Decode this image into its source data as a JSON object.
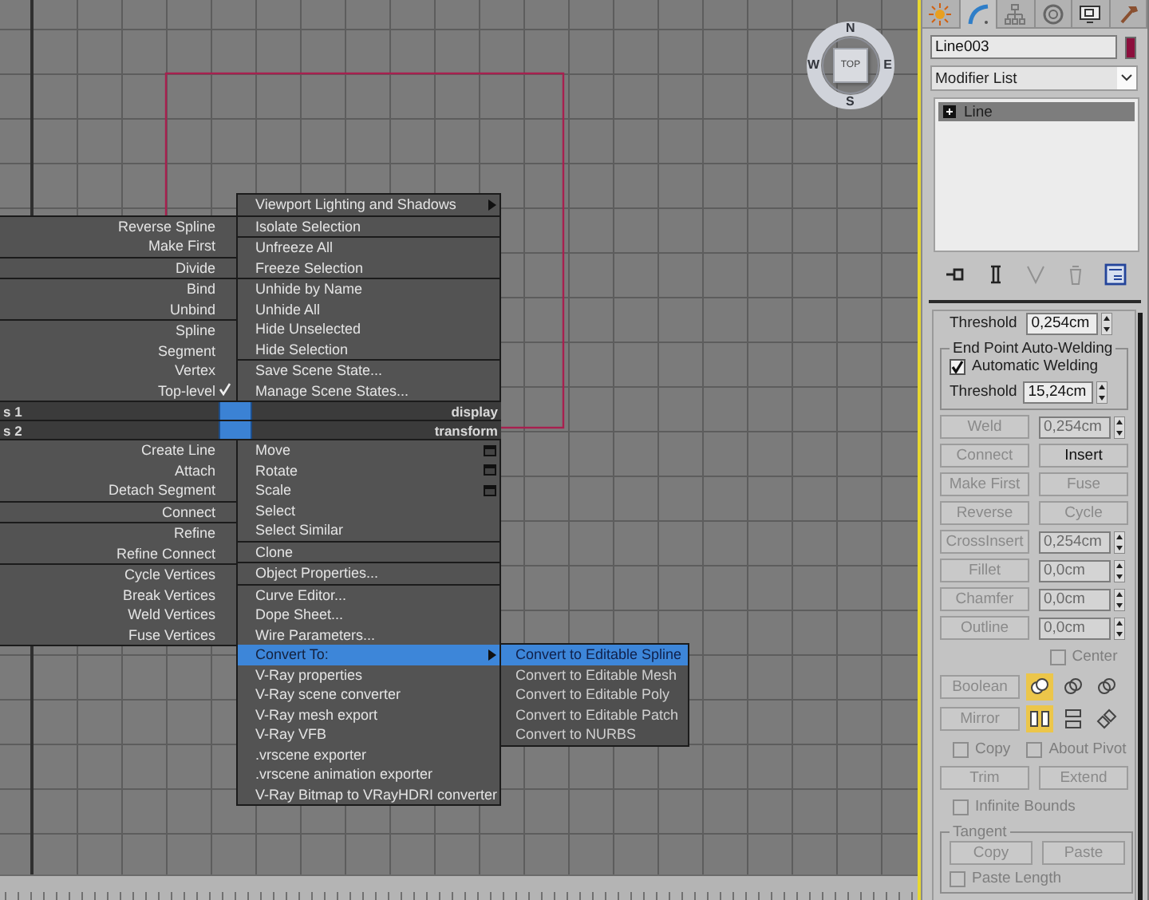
{
  "viewport": {
    "viewcube": {
      "face": "TOP",
      "north": "N",
      "east": "E",
      "south": "S",
      "west": "W"
    }
  },
  "quad_menu": {
    "upper_left": [
      [
        {
          "label": "Reverse Spline",
          "selected": false
        },
        {
          "label": "Make First",
          "selected": false
        }
      ],
      [
        {
          "label": "Divide",
          "selected": false
        }
      ],
      [
        {
          "label": "Bind",
          "selected": false
        },
        {
          "label": "Unbind",
          "selected": false
        }
      ],
      [
        {
          "label": "Spline",
          "selected": false,
          "checked": false
        },
        {
          "label": "Segment",
          "selected": false,
          "checked": false
        },
        {
          "label": "Vertex",
          "selected": false,
          "checked": false
        },
        {
          "label": "Top-level",
          "selected": false,
          "checked": true
        }
      ]
    ],
    "upper_right": [
      [
        {
          "label": "Viewport Lighting and Shadows",
          "kind": "submenu",
          "selected": false
        }
      ],
      [
        {
          "label": "Isolate Selection",
          "kind": "command",
          "selected": false
        }
      ],
      [
        {
          "label": "Unfreeze All",
          "kind": "command",
          "selected": false
        },
        {
          "label": "Freeze Selection",
          "kind": "command",
          "selected": false
        }
      ],
      [
        {
          "label": "Unhide by Name",
          "kind": "command",
          "selected": false
        },
        {
          "label": "Unhide All",
          "kind": "command",
          "selected": false
        },
        {
          "label": "Hide Unselected",
          "kind": "command",
          "selected": false
        },
        {
          "label": "Hide Selection",
          "kind": "command",
          "selected": false
        }
      ],
      [
        {
          "label": "Save Scene State...",
          "kind": "command",
          "selected": false
        },
        {
          "label": "Manage Scene States...",
          "kind": "command",
          "selected": false
        }
      ]
    ],
    "headers": [
      {
        "left": "s 1",
        "right": "display"
      },
      {
        "left": "s 2",
        "right": "transform"
      }
    ],
    "lower_left": [
      [
        {
          "label": "Create Line",
          "selected": false
        },
        {
          "label": "Attach",
          "selected": false
        },
        {
          "label": "Detach Segment",
          "selected": false
        }
      ],
      [
        {
          "label": "Connect",
          "selected": false
        }
      ],
      [
        {
          "label": "Refine",
          "selected": false
        },
        {
          "label": "Refine Connect",
          "selected": false
        }
      ],
      [
        {
          "label": "Cycle Vertices",
          "selected": false
        },
        {
          "label": "Break Vertices",
          "selected": false
        },
        {
          "label": "Weld Vertices",
          "selected": false
        },
        {
          "label": "Fuse Vertices",
          "selected": false
        }
      ]
    ],
    "lower_right": [
      [
        {
          "label": "Move",
          "kind": "option",
          "selected": false
        },
        {
          "label": "Rotate",
          "kind": "option",
          "selected": false
        },
        {
          "label": "Scale",
          "kind": "option",
          "selected": false
        },
        {
          "label": "Select",
          "kind": "command",
          "selected": false
        },
        {
          "label": "Select Similar",
          "kind": "command",
          "selected": false
        }
      ],
      [
        {
          "label": "Clone",
          "kind": "command",
          "selected": false
        }
      ],
      [
        {
          "label": "Object Properties...",
          "kind": "command",
          "selected": false
        }
      ],
      [
        {
          "label": "Curve Editor...",
          "kind": "command",
          "selected": false
        },
        {
          "label": "Dope Sheet...",
          "kind": "command",
          "selected": false
        },
        {
          "label": "Wire Parameters...",
          "kind": "command",
          "selected": false
        },
        {
          "label": "Convert To:",
          "kind": "submenu",
          "selected": true,
          "children": [
            {
              "label": "Convert to Editable Spline",
              "selected": true
            },
            {
              "label": "Convert to Editable Mesh",
              "selected": false
            },
            {
              "label": "Convert to Editable Poly",
              "selected": false
            },
            {
              "label": "Convert to Editable Patch",
              "selected": false
            },
            {
              "label": "Convert to NURBS",
              "selected": false
            }
          ]
        },
        {
          "label": "V-Ray properties",
          "kind": "command",
          "selected": false
        },
        {
          "label": "V-Ray scene converter",
          "kind": "command",
          "selected": false
        },
        {
          "label": "V-Ray mesh export",
          "kind": "command",
          "selected": false
        },
        {
          "label": "V-Ray VFB",
          "kind": "command",
          "selected": false
        },
        {
          "label": ".vrscene exporter",
          "kind": "command",
          "selected": false
        },
        {
          "label": ".vrscene animation exporter",
          "kind": "command",
          "selected": false
        },
        {
          "label": "V-Ray Bitmap to VRayHDRI converter",
          "kind": "command",
          "selected": false
        }
      ]
    ]
  },
  "command_panel": {
    "tabs": [
      {
        "selected": false
      },
      {
        "selected": true
      },
      {
        "selected": false
      },
      {
        "selected": false
      },
      {
        "selected": false
      },
      {
        "selected": false
      }
    ],
    "object_name": {
      "value": "Line003",
      "color": "#8c0f3d"
    },
    "modifier_list": {
      "value": "Modifier List"
    },
    "modifier_stack": [
      {
        "label": "Line",
        "selected": true,
        "expanded": false
      }
    ],
    "stack_toolbar": [
      {
        "disabled": false
      },
      {
        "disabled": false
      },
      {
        "disabled": true
      },
      {
        "disabled": true
      },
      {
        "disabled": false
      }
    ],
    "rollout": {
      "cut_row": {
        "label": "Threshold",
        "value": "0,254cm"
      },
      "welding_group": {
        "title": "End Point Auto-Welding",
        "automatic": {
          "label": "Automatic Welding",
          "checked": true
        },
        "threshold": {
          "label": "Threshold",
          "value": "15,24cm"
        }
      },
      "rows": [
        {
          "kind": "button_spinner",
          "button": {
            "label": "Weld",
            "disabled": true
          },
          "spinner": {
            "value": "0,254cm",
            "disabled": true
          }
        },
        {
          "kind": "button_pair",
          "buttons": [
            {
              "label": "Connect",
              "disabled": true
            },
            {
              "label": "Insert",
              "disabled": false
            }
          ]
        },
        {
          "kind": "button_pair",
          "buttons": [
            {
              "label": "Make First",
              "disabled": true
            },
            {
              "label": "Fuse",
              "disabled": true
            }
          ]
        },
        {
          "kind": "button_pair",
          "buttons": [
            {
              "label": "Reverse",
              "disabled": true
            },
            {
              "label": "Cycle",
              "disabled": true
            }
          ]
        },
        {
          "kind": "button_spinner",
          "button": {
            "label": "CrossInsert",
            "disabled": true
          },
          "spinner": {
            "value": "0,254cm",
            "disabled": true
          }
        },
        {
          "kind": "button_spinner",
          "button": {
            "label": "Fillet",
            "disabled": true
          },
          "spinner": {
            "value": "0,0cm",
            "disabled": true
          }
        },
        {
          "kind": "button_spinner",
          "button": {
            "label": "Chamfer",
            "disabled": true
          },
          "spinner": {
            "value": "0,0cm",
            "disabled": true
          }
        },
        {
          "kind": "button_spinner",
          "button": {
            "label": "Outline",
            "disabled": true
          },
          "spinner": {
            "value": "0,0cm",
            "disabled": true
          }
        },
        {
          "kind": "checkbox_right",
          "checkboxes": [
            {
              "label": "Center",
              "checked": false,
              "disabled": true
            }
          ]
        },
        {
          "kind": "boolean_toggles",
          "button": {
            "label": "Boolean",
            "disabled": true
          },
          "toggles": [
            {
              "selected": true
            },
            {
              "selected": false
            },
            {
              "selected": false
            }
          ]
        },
        {
          "kind": "mirror_toggles",
          "button": {
            "label": "Mirror",
            "disabled": true
          },
          "toggles": [
            {
              "selected": true
            },
            {
              "selected": false
            },
            {
              "selected": false
            }
          ]
        },
        {
          "kind": "checkbox_pair",
          "checkboxes": [
            {
              "label": "Copy",
              "checked": false,
              "disabled": true
            },
            {
              "label": "About Pivot",
              "checked": false,
              "disabled": true
            }
          ]
        },
        {
          "kind": "button_pair",
          "buttons": [
            {
              "label": "Trim",
              "disabled": true
            },
            {
              "label": "Extend",
              "disabled": true
            }
          ]
        },
        {
          "kind": "checkbox_left",
          "checkboxes": [
            {
              "label": "Infinite Bounds",
              "checked": false,
              "disabled": true
            }
          ]
        }
      ],
      "tangent_group": {
        "title": "Tangent",
        "buttons": [
          {
            "label": "Copy",
            "disabled": true
          },
          {
            "label": "Paste",
            "disabled": true
          }
        ],
        "checkbox": {
          "label": "Paste Length",
          "checked": false,
          "disabled": true
        }
      }
    }
  }
}
